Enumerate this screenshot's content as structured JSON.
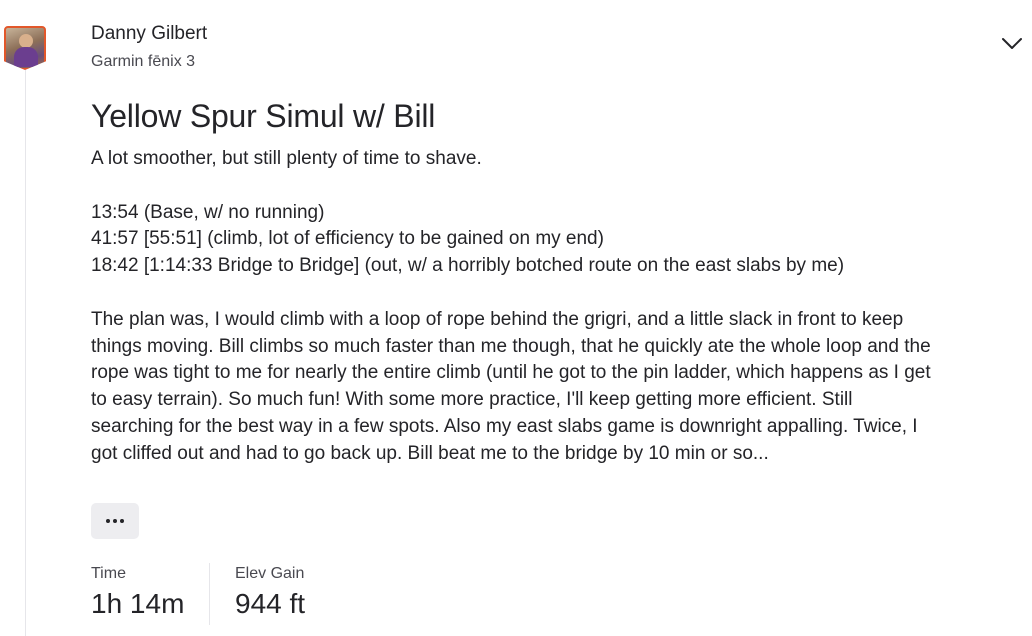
{
  "athlete": {
    "name": "Danny Gilbert",
    "device": "Garmin fēnix 3"
  },
  "activity": {
    "title": "Yellow Spur Simul w/ Bill",
    "description": {
      "summary": "A lot smoother, but still plenty of time to shave.",
      "splits": [
        "13:54 (Base, w/ no running)",
        "41:57 [55:51] (climb, lot of efficiency to be gained on my end)",
        "18:42 [1:14:33 Bridge to Bridge] (out, w/ a horribly botched route on the east slabs by me)"
      ],
      "body": "The plan was, I would climb with a loop of rope behind the grigri, and a little slack in front to keep things moving. Bill climbs so much faster than me though, that he quickly ate the whole loop and the rope was tight to me for nearly the entire climb (until he got to the pin ladder, which happens as I get to easy terrain). So much fun! With some more practice, I'll keep getting more efficient. Still searching for the best way in a few spots. Also my east slabs game is downright appalling. Twice, I got cliffed out and had to go back up. Bill beat me to the bridge by 10 min or so..."
    },
    "stats": [
      {
        "label": "Time",
        "value": "1h 14m"
      },
      {
        "label": "Elev Gain",
        "value": "944 ft"
      }
    ]
  },
  "icons": {
    "expand": "chevron-down-icon",
    "more": "more-horizontal-icon"
  },
  "colors": {
    "avatar_border": "#e2572a",
    "text_primary": "#242428",
    "text_secondary": "#494950",
    "button_bg": "#ededf0"
  }
}
